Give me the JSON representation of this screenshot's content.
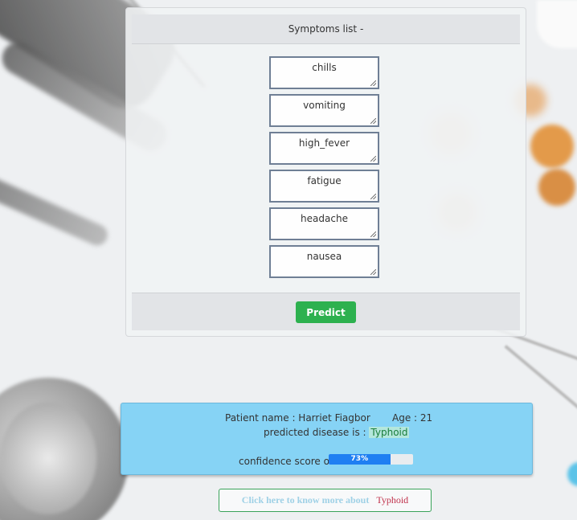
{
  "card": {
    "header": "Symptoms list -",
    "symptoms": [
      "chills",
      "vomiting",
      "high_fever",
      "fatigue",
      "headache",
      "nausea"
    ],
    "predict_label": "Predict"
  },
  "result": {
    "patient_label": "Patient name : Harriet Fiagbor",
    "age_label": "Age : 21",
    "predicted_prefix": "predicted disease is :",
    "disease": "Typhoid",
    "confidence_label": "confidence score of :",
    "confidence": 73,
    "confidence_text": "73%"
  },
  "more": {
    "prefix": "Click here to know more about",
    "disease": "Typhoid"
  },
  "colors": {
    "predict_button": "#2db14f",
    "result_bg": "#86d3f5",
    "progress_fill": "#1f7ff2",
    "disease_link": "#c0304a"
  }
}
